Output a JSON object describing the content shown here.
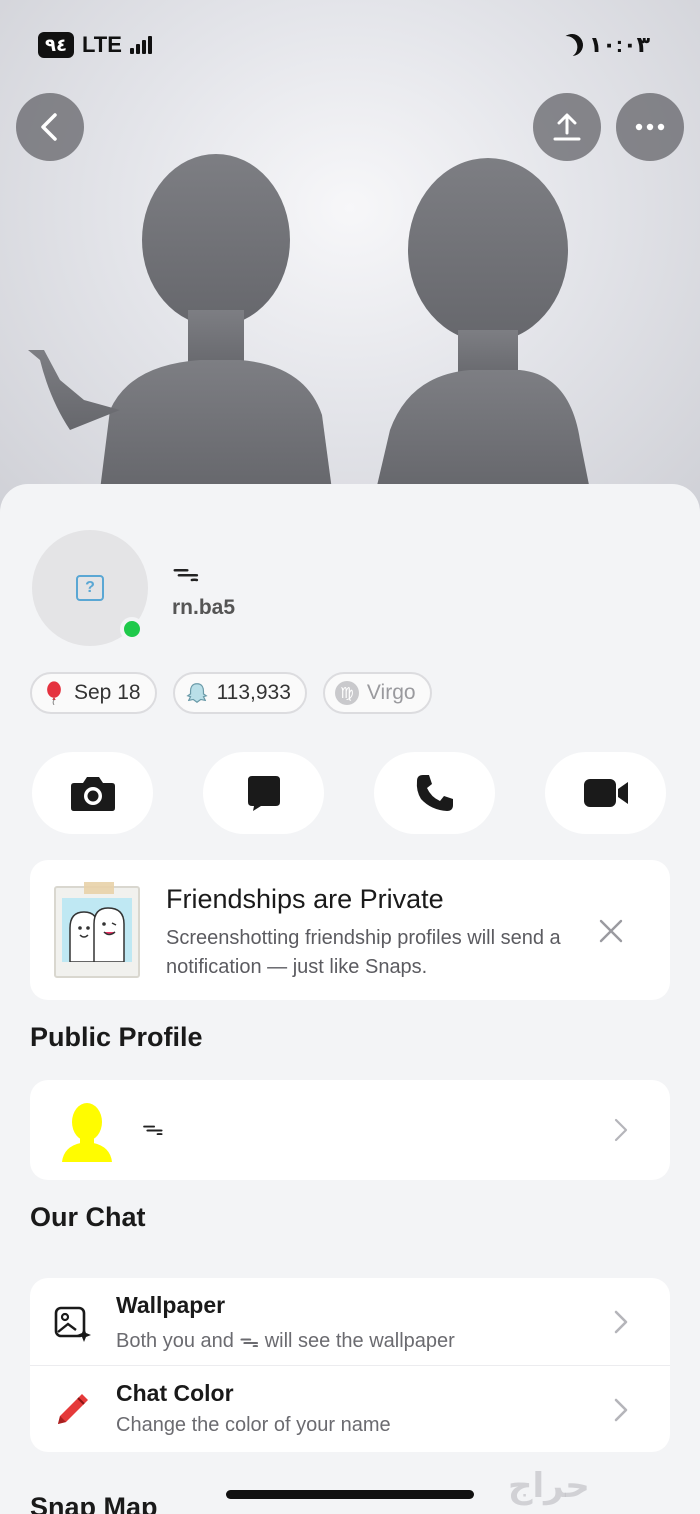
{
  "status_bar": {
    "battery": "٩٤",
    "network": "LTE",
    "time": "١٠:٠٣"
  },
  "header": {
    "back_icon": "chevron-left-icon",
    "share_icon": "upload-icon",
    "more_icon": "more-dots-icon"
  },
  "profile": {
    "display_name": "ᯓ",
    "username": "rn.ba5",
    "online_color": "#1ec94a"
  },
  "chips": [
    {
      "icon": "balloon-icon",
      "label": "Sep 18"
    },
    {
      "icon": "ghost-icon",
      "label": "113,933"
    },
    {
      "icon": "virgo-icon",
      "label": "Virgo"
    }
  ],
  "actions": [
    {
      "icon": "camera-icon"
    },
    {
      "icon": "chat-icon"
    },
    {
      "icon": "phone-icon"
    },
    {
      "icon": "video-icon"
    }
  ],
  "private_notice": {
    "title": "Friendships are Private",
    "text": "Screenshotting friendship profiles will send a notification — just like Snaps."
  },
  "public_profile": {
    "section_title": "Public Profile",
    "name": "ᯓ"
  },
  "our_chat": {
    "section_title": "Our Chat",
    "rows": [
      {
        "icon": "wallpaper-icon",
        "title": "Wallpaper",
        "subtitle": "Both you and ᯓ will see the wallpaper"
      },
      {
        "icon": "crayon-icon",
        "title": "Chat Color",
        "subtitle": "Change the color of your name"
      }
    ]
  },
  "snap_map": {
    "section_title": "Snap Map"
  },
  "watermark": "حراج",
  "colors": {
    "brand_yellow": "#fffc00",
    "background": "#f3f4f6",
    "card": "#ffffff"
  }
}
